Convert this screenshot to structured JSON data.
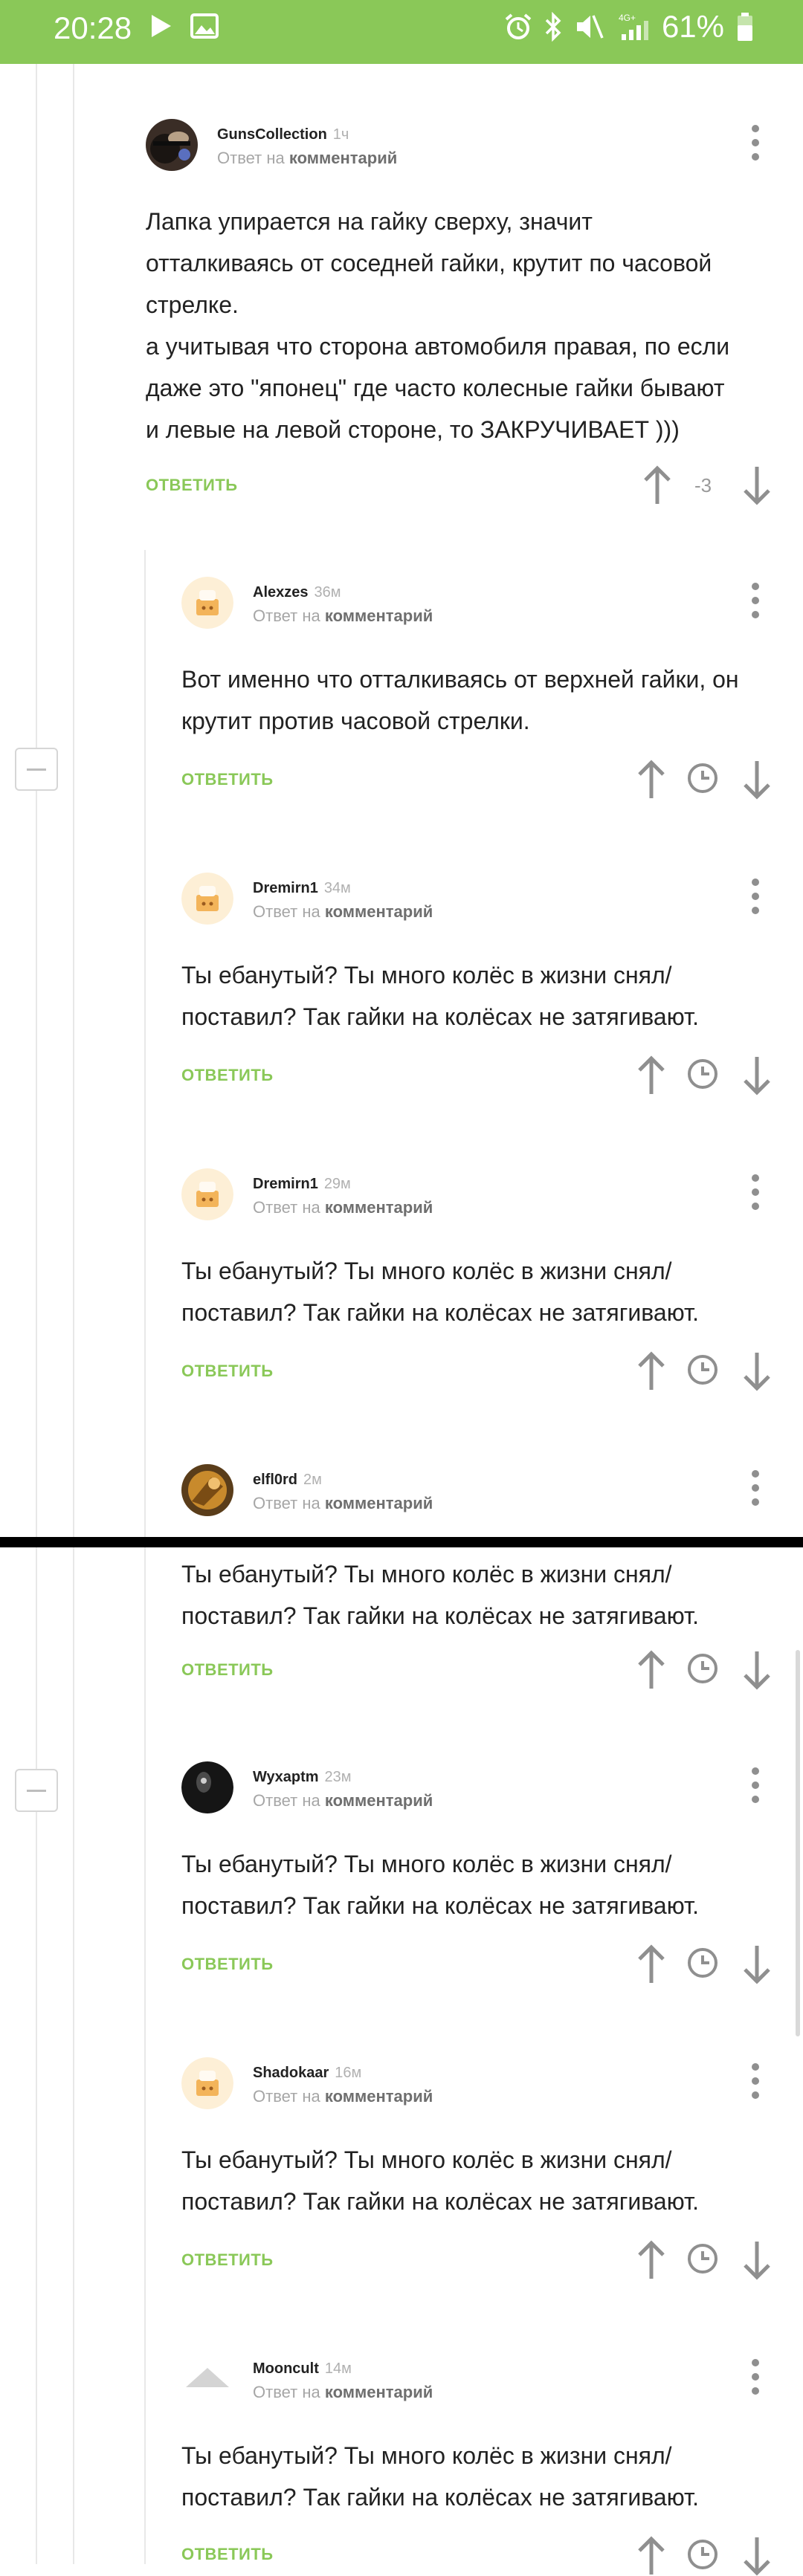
{
  "statusbar": {
    "time": "20:28",
    "battery_pct": "61%",
    "network_label": "4G+",
    "icons": [
      "play-icon",
      "image-icon",
      "alarm-icon",
      "bluetooth-icon",
      "mute-icon",
      "signal-icon",
      "battery-icon"
    ]
  },
  "reply_word": "Ответ на",
  "reply_target": "комментарий",
  "reply_button": "ОТВЕТИТЬ",
  "colors": {
    "accent": "#8ac858",
    "text": "#222222",
    "muted": "#a6a6a6",
    "icon": "#8f8f8f"
  },
  "comments": [
    {
      "author": "GunsCollection",
      "time": "1ч",
      "avatar": "guns-avatar",
      "rating": "-3",
      "text": "Лапка упирается на гайку сверху, значит\nотталкиваясь от соседней гайки, крутит по часовой\nстрелке.\nа учитывая что сторона автомобиля правая, по если\nдаже это \"японец\" где часто колесные гайки бывают\nи левые на левой стороне, то ЗАКРУЧИВАЕТ )))"
    },
    {
      "author": "Alexzes",
      "time": "36м",
      "avatar": "default-avatar",
      "text": "Вот именно что отталкиваясь от верхней гайки, он\nкрутит против часовой стрелки."
    },
    {
      "author": "Dremirn1",
      "time": "34м",
      "avatar": "default-avatar",
      "text": "Ты ебанутый? Ты много колёс в жизни снял/\nпоставил? Так гайки на колёсах не затягивают."
    },
    {
      "author": "Dremirn1",
      "time": "29м",
      "avatar": "default-avatar",
      "text": "Ты ебанутый? Ты много колёс в жизни снял/\nпоставил? Так гайки на колёсах не затягивают."
    },
    {
      "author": "elfl0rd",
      "time": "2м",
      "avatar": "elf-avatar",
      "text": "Ты ебанутый? Ты много колёс в жизни снял/\nпоставил? Так гайки на колёсах не затягивают."
    },
    {
      "author": "Wyxaptm",
      "time": "23м",
      "avatar": "dark-avatar",
      "text": "Ты ебанутый? Ты много колёс в жизни снял/\nпоставил? Так гайки на колёсах не затягивают."
    },
    {
      "author": "Shadokaar",
      "time": "16м",
      "avatar": "default-avatar",
      "text": "Ты ебанутый? Ты много колёс в жизни снял/\nпоставил? Так гайки на колёсах не затягивают."
    },
    {
      "author": "Mooncult",
      "time": "14м",
      "avatar": "triangle-avatar",
      "text": "Ты ебанутый? Ты много колёс в жизни снял/\nпоставил? Так гайки на колёсах не затягивают."
    }
  ]
}
